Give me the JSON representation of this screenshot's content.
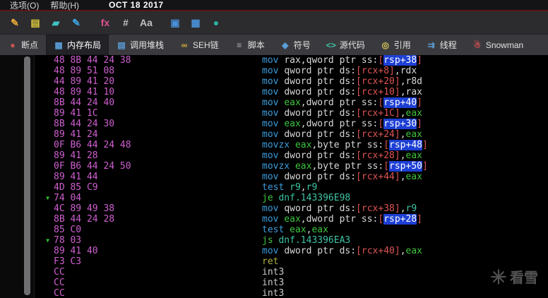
{
  "palette": {
    "menu-bg": "#141417",
    "menu-underline": "#5a1515",
    "toolbar-bg": "#2c2c2f",
    "tabbar-bg": "#3a3a3e",
    "tab-active-bg": "#232327",
    "disasm-bg": "#000000",
    "hex-bytes": "#cf5fd0",
    "mnemonic": "#3b9ddd",
    "plain": "#d8d8d8",
    "mem-ref": "#e05454",
    "stack-bg": "#1d3fd4",
    "stack-fg": "#ffffff",
    "reg-green": "#3ec43e",
    "reg-teal": "#3ec4a4",
    "jcc": "#3ec43e",
    "jump-target": "#3ec4a4",
    "ret": "#b0b040",
    "int3": "#c8c8c8",
    "arrow-green": "#2fc22f",
    "watermark": "#9a9a9a"
  },
  "menu": {
    "items": [
      {
        "name": "menu-item-options",
        "label": "选项(O)"
      },
      {
        "name": "menu-item-help",
        "label": "帮助(H)"
      }
    ],
    "build_date": "OCT 18 2017"
  },
  "toolbar": {
    "icons": [
      {
        "name": "edit-icon",
        "glyph": "✎",
        "color": "#e8a839"
      },
      {
        "name": "notes-icon",
        "glyph": "▤",
        "color": "#e0cc3a"
      },
      {
        "name": "highlighter-icon",
        "glyph": "▰",
        "color": "#3fc4c4"
      },
      {
        "name": "pen-icon",
        "glyph": "✎",
        "color": "#3fa4e0"
      },
      {
        "name": "fx-icon",
        "glyph": "fx",
        "color": "#e05090"
      },
      {
        "name": "hash-icon",
        "glyph": "#",
        "color": "#c0c0c0"
      },
      {
        "name": "font-size-icon",
        "glyph": "Aa",
        "color": "#c0c0c0"
      },
      {
        "name": "copy-icon",
        "glyph": "▣",
        "color": "#4a90d9"
      },
      {
        "name": "pages-icon",
        "glyph": "▦",
        "color": "#4a90d9"
      },
      {
        "name": "globe-icon",
        "glyph": "●",
        "color": "#2fb0a0"
      }
    ]
  },
  "tabs": [
    {
      "name": "tab-breakpoints",
      "icon": "breakpoint-icon",
      "glyph": "●",
      "color": "#cc5555",
      "label": "断点",
      "active": false
    },
    {
      "name": "tab-memory-map",
      "icon": "memory-icon",
      "glyph": "▦",
      "color": "#5a9fd9",
      "label": "内存布局",
      "active": true
    },
    {
      "name": "tab-call-stack",
      "icon": "callstack-icon",
      "glyph": "▤",
      "color": "#5a9fd9",
      "label": "调用堆栈",
      "active": false
    },
    {
      "name": "tab-seh-chain",
      "icon": "chain-icon",
      "glyph": "∞",
      "color": "#d9b03a",
      "label": "SEH链",
      "active": false
    },
    {
      "name": "tab-script",
      "icon": "script-icon",
      "glyph": "≡",
      "color": "#b0b0b0",
      "label": "脚本",
      "active": false
    },
    {
      "name": "tab-symbols",
      "icon": "symbols-icon",
      "glyph": "◆",
      "color": "#5a9fd9",
      "label": "符号",
      "active": false
    },
    {
      "name": "tab-source",
      "icon": "source-code-icon",
      "glyph": "<>",
      "color": "#3fc4a4",
      "label": "源代码",
      "active": false
    },
    {
      "name": "tab-references",
      "icon": "references-icon",
      "glyph": "◎",
      "color": "#d9c95a",
      "label": "引用",
      "active": false
    },
    {
      "name": "tab-threads",
      "icon": "threads-icon",
      "glyph": "⇉",
      "color": "#5a9fd9",
      "label": "线程",
      "active": false
    },
    {
      "name": "tab-snowman",
      "icon": "snowman-icon",
      "glyph": "☃",
      "color": "#d05050",
      "label": "Snowman",
      "active": false
    }
  ],
  "disasm": {
    "lines": [
      {
        "arrow": false,
        "bytes": "48 8B 44 24 38",
        "tokens": [
          [
            "mov ",
            "mn"
          ],
          [
            "rax",
            "pl"
          ],
          [
            ",",
            "pl"
          ],
          [
            "qword ptr ss:",
            "pl"
          ],
          [
            "[",
            "mem"
          ],
          [
            "rsp+38",
            "stk"
          ],
          [
            "]",
            "mem"
          ]
        ]
      },
      {
        "arrow": false,
        "bytes": "48 89 51 08",
        "tokens": [
          [
            "mov ",
            "mn"
          ],
          [
            "qword ptr ds:",
            "pl"
          ],
          [
            "[rcx+8]",
            "mem"
          ],
          [
            ",",
            "pl"
          ],
          [
            "rdx",
            "pl"
          ]
        ]
      },
      {
        "arrow": false,
        "bytes": "44 89 41 20",
        "tokens": [
          [
            "mov ",
            "mn"
          ],
          [
            "dword ptr ds:",
            "pl"
          ],
          [
            "[rcx+20]",
            "mem"
          ],
          [
            ",",
            "pl"
          ],
          [
            "r8d",
            "pl"
          ]
        ]
      },
      {
        "arrow": false,
        "bytes": "48 89 41 10",
        "tokens": [
          [
            "mov ",
            "mn"
          ],
          [
            "dword ptr ds:",
            "pl"
          ],
          [
            "[rcx+10]",
            "mem"
          ],
          [
            ",",
            "pl"
          ],
          [
            "rax",
            "pl"
          ]
        ]
      },
      {
        "arrow": false,
        "bytes": "8B 44 24 40",
        "tokens": [
          [
            "mov ",
            "mn"
          ],
          [
            "eax",
            "rE"
          ],
          [
            ",",
            "pl"
          ],
          [
            "dword ptr ss:",
            "pl"
          ],
          [
            "[",
            "mem"
          ],
          [
            "rsp+40",
            "stk"
          ],
          [
            "]",
            "mem"
          ]
        ]
      },
      {
        "arrow": false,
        "bytes": "89 41 1C",
        "tokens": [
          [
            "mov ",
            "mn"
          ],
          [
            "dword ptr ds:",
            "pl"
          ],
          [
            "[rcx+1C]",
            "mem"
          ],
          [
            ",",
            "pl"
          ],
          [
            "eax",
            "rE"
          ]
        ]
      },
      {
        "arrow": false,
        "bytes": "8B 44 24 30",
        "tokens": [
          [
            "mov ",
            "mn"
          ],
          [
            "eax",
            "rE"
          ],
          [
            ",",
            "pl"
          ],
          [
            "dword ptr ss:",
            "pl"
          ],
          [
            "[",
            "mem"
          ],
          [
            "rsp+30",
            "stk"
          ],
          [
            "]",
            "mem"
          ]
        ]
      },
      {
        "arrow": false,
        "bytes": "89 41 24",
        "tokens": [
          [
            "mov ",
            "mn"
          ],
          [
            "dword ptr ds:",
            "pl"
          ],
          [
            "[rcx+24]",
            "mem"
          ],
          [
            ",",
            "pl"
          ],
          [
            "eax",
            "rE"
          ]
        ]
      },
      {
        "arrow": false,
        "bytes": "0F B6 44 24 48",
        "tokens": [
          [
            "movzx ",
            "mn"
          ],
          [
            "eax",
            "rE"
          ],
          [
            ",",
            "pl"
          ],
          [
            "byte ptr ss:",
            "pl"
          ],
          [
            "[",
            "mem"
          ],
          [
            "rsp+48",
            "stk"
          ],
          [
            "]",
            "mem"
          ]
        ]
      },
      {
        "arrow": false,
        "bytes": "89 41 28",
        "tokens": [
          [
            "mov ",
            "mn"
          ],
          [
            "dword ptr ds:",
            "pl"
          ],
          [
            "[rcx+28]",
            "mem"
          ],
          [
            ",",
            "pl"
          ],
          [
            "eax",
            "rE"
          ]
        ]
      },
      {
        "arrow": false,
        "bytes": "0F B6 44 24 50",
        "tokens": [
          [
            "movzx ",
            "mn"
          ],
          [
            "eax",
            "rE"
          ],
          [
            ",",
            "pl"
          ],
          [
            "byte ptr ss:",
            "pl"
          ],
          [
            "[",
            "mem"
          ],
          [
            "rsp+50",
            "stk"
          ],
          [
            "]",
            "mem"
          ]
        ]
      },
      {
        "arrow": false,
        "bytes": "89 41 44",
        "tokens": [
          [
            "mov ",
            "mn"
          ],
          [
            "dword ptr ds:",
            "pl"
          ],
          [
            "[rcx+44]",
            "mem"
          ],
          [
            ",",
            "pl"
          ],
          [
            "eax",
            "rE"
          ]
        ]
      },
      {
        "arrow": false,
        "bytes": "4D 85 C9",
        "tokens": [
          [
            "test ",
            "mn"
          ],
          [
            "r9",
            "rC"
          ],
          [
            ",",
            "pl"
          ],
          [
            "r9",
            "rC"
          ]
        ]
      },
      {
        "arrow": true,
        "bytes": "74 04",
        "tokens": [
          [
            "je ",
            "jcc"
          ],
          [
            "dnf.143396E98",
            "tgt"
          ]
        ]
      },
      {
        "arrow": false,
        "bytes": "4C 89 49 38",
        "tokens": [
          [
            "mov ",
            "mn"
          ],
          [
            "qword ptr ds:",
            "pl"
          ],
          [
            "[rcx+38]",
            "mem"
          ],
          [
            ",",
            "pl"
          ],
          [
            "r9",
            "rC"
          ]
        ]
      },
      {
        "arrow": false,
        "bytes": "8B 44 24 28",
        "tokens": [
          [
            "mov ",
            "mn"
          ],
          [
            "eax",
            "rE"
          ],
          [
            ",",
            "pl"
          ],
          [
            "dword ptr ss:",
            "pl"
          ],
          [
            "[",
            "mem"
          ],
          [
            "rsp+28",
            "stk"
          ],
          [
            "]",
            "mem"
          ]
        ]
      },
      {
        "arrow": false,
        "bytes": "85 C0",
        "tokens": [
          [
            "test ",
            "mn"
          ],
          [
            "eax",
            "rE"
          ],
          [
            ",",
            "pl"
          ],
          [
            "eax",
            "rE"
          ]
        ]
      },
      {
        "arrow": true,
        "bytes": "78 03",
        "tokens": [
          [
            "js ",
            "jcc"
          ],
          [
            "dnf.143396EA3",
            "tgt"
          ]
        ]
      },
      {
        "arrow": false,
        "bytes": "89 41 40",
        "tokens": [
          [
            "mov ",
            "mn"
          ],
          [
            "dword ptr ds:",
            "pl"
          ],
          [
            "[rcx+40]",
            "mem"
          ],
          [
            ",",
            "pl"
          ],
          [
            "eax",
            "rE"
          ]
        ]
      },
      {
        "arrow": false,
        "bytes": "F3 C3",
        "tokens": [
          [
            "ret",
            "ret"
          ]
        ]
      },
      {
        "arrow": false,
        "bytes": "CC",
        "tokens": [
          [
            "int3",
            "int3"
          ]
        ]
      },
      {
        "arrow": false,
        "bytes": "CC",
        "tokens": [
          [
            "int3",
            "int3"
          ]
        ]
      },
      {
        "arrow": false,
        "bytes": "CC",
        "tokens": [
          [
            "int3",
            "int3"
          ]
        ]
      }
    ]
  },
  "watermark": {
    "text": "看雪"
  }
}
